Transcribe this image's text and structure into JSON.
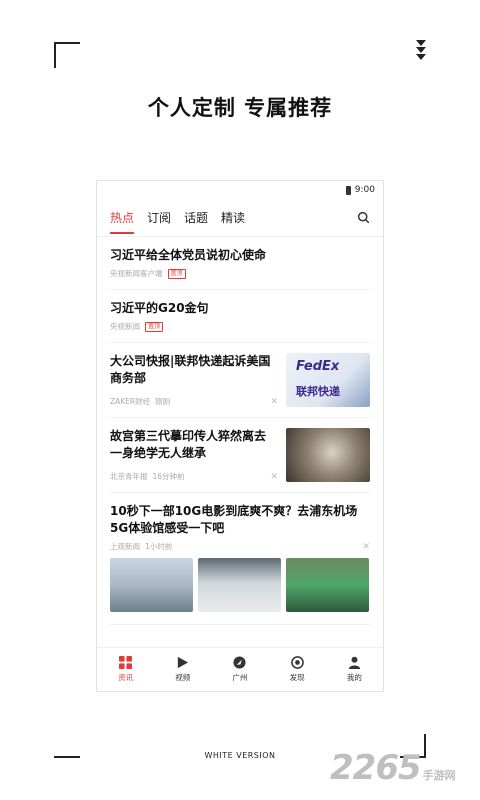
{
  "headline": "个人定制  专属推荐",
  "status": {
    "time": "9:00"
  },
  "tabs": [
    {
      "label": "热点",
      "active": true
    },
    {
      "label": "订阅",
      "active": false
    },
    {
      "label": "话题",
      "active": false
    },
    {
      "label": "精读",
      "active": false
    }
  ],
  "news": [
    {
      "title": "习近平给全体党员说初心使命",
      "source": "央视新闻客户端",
      "badge": "置顶"
    },
    {
      "title": "习近平的G20金句",
      "source": "央视新闻",
      "badge": "置顶"
    },
    {
      "title": "大公司快报|联邦快递起诉美国商务部",
      "source": "ZAKER财经",
      "time": "刚刚",
      "thumb_text": "FedEx 联邦快递"
    },
    {
      "title": "故宫第三代摹印传人猝然离去 一身绝学无人继承",
      "source": "北京青年报",
      "time": "16分钟前"
    },
    {
      "title": "10秒下一部10G电影到底爽不爽？去浦东机场5G体验馆感受一下吧",
      "source": "上观新闻",
      "time": "1小时前"
    }
  ],
  "bottom_nav": [
    {
      "label": "资讯",
      "icon": "grid-icon",
      "active": true
    },
    {
      "label": "视频",
      "icon": "play-icon",
      "active": false
    },
    {
      "label": "广州",
      "icon": "location-icon",
      "active": false
    },
    {
      "label": "发现",
      "icon": "target-icon",
      "active": false
    },
    {
      "label": "我的",
      "icon": "user-icon",
      "active": false
    }
  ],
  "footer_label": "WHITE VERSION",
  "watermark": {
    "number": "2265",
    "text": "手游网"
  },
  "colors": {
    "accent": "#e23b3b",
    "text": "#111111",
    "muted": "#aaaaaa"
  }
}
